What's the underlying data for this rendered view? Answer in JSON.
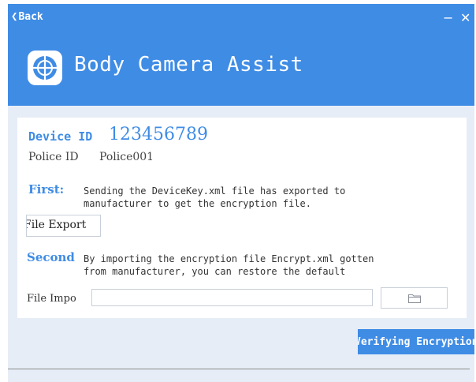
{
  "header": {
    "back_label": "Back",
    "minimize_symbol": "−",
    "close_symbol": "✕",
    "app_title": "Body Camera Assist",
    "logo_icon": "crosshair-globe-icon"
  },
  "device": {
    "device_id_label": "Device ID",
    "device_id_value": "123456789",
    "police_id_label": "Police ID",
    "police_id_value": "Police001"
  },
  "steps": {
    "first": {
      "label": "First:",
      "line1": "Sending the DeviceKey.xml file has exported to",
      "line2": "manufacturer to get the encryption file.",
      "button_label": "File Export"
    },
    "second": {
      "label": "Second",
      "line1": "By importing the encryption file Encrypt.xml gotten",
      "line2": "from manufacturer, you can restore the default"
    }
  },
  "file_import": {
    "label": "File Impo",
    "value": "",
    "browse_icon": "folder-icon"
  },
  "actions": {
    "verify_label": "Verifying Encryption"
  },
  "colors": {
    "accent": "#3f8ce5",
    "panel": "#e6edf7"
  }
}
